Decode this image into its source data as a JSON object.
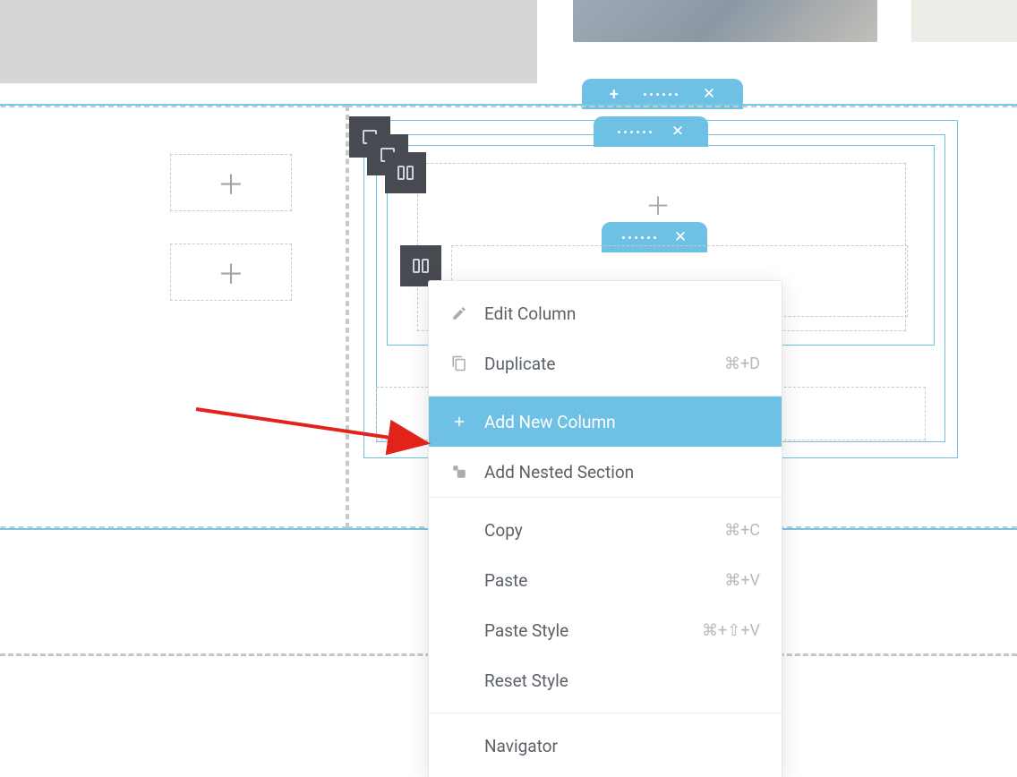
{
  "menu": {
    "edit_column": "Edit Column",
    "duplicate": "Duplicate",
    "duplicate_short": "⌘+D",
    "add_new_column": "Add New Column",
    "add_nested_section": "Add Nested Section",
    "copy": "Copy",
    "copy_short": "⌘+C",
    "paste": "Paste",
    "paste_short": "⌘+V",
    "paste_style": "Paste Style",
    "paste_style_short": "⌘+⇧+V",
    "reset_style": "Reset Style",
    "navigator": "Navigator"
  }
}
